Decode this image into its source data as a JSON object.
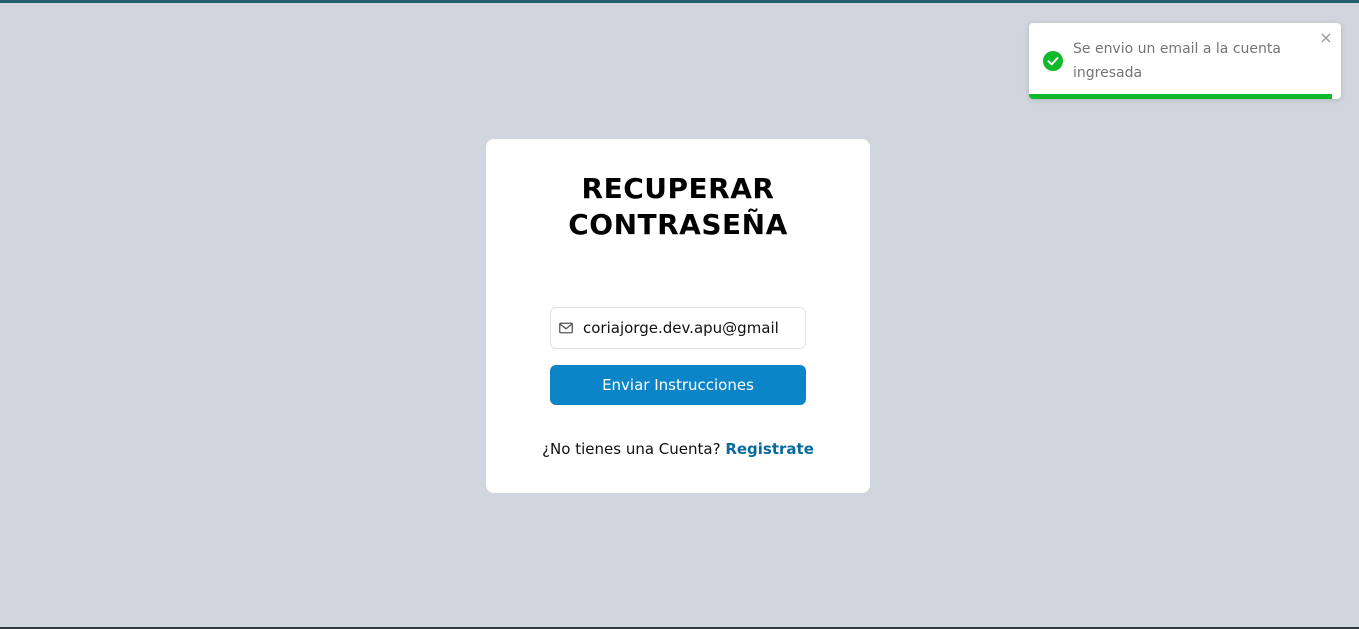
{
  "page": {
    "background_color": "#d1d5dd",
    "accent_color": "#0b85c7"
  },
  "card": {
    "title_line1": "RECUPERAR",
    "title_line2": "CONTRASEÑA",
    "email_icon": "mail-icon",
    "email_value": "coriajorge.dev.apu@gmail",
    "submit_label": "Enviar Instrucciones",
    "register_prompt": "¿No tienes una Cuenta? ",
    "register_link": "Registrate"
  },
  "toast": {
    "icon": "check-circle-icon",
    "icon_color": "#10b82b",
    "message": "Se envio un email a la cuenta ingresada",
    "close_symbol": "×",
    "progress_fraction": 0.97,
    "progress_color": "#10b82b"
  }
}
